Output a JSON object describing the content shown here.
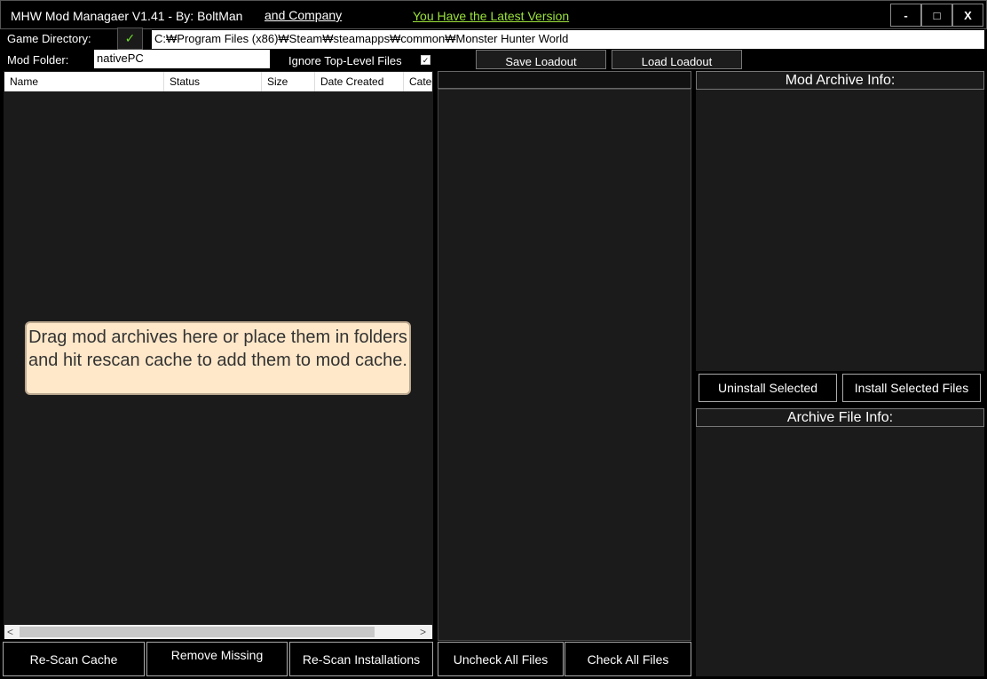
{
  "window": {
    "title": "MHW Mod Managaer V1.41 - By: BoltMan",
    "company_link": "and Company",
    "version_status": "You Have the Latest Version",
    "version_color": "#9be23a",
    "minimize": "-",
    "maximize": "□",
    "close": "X"
  },
  "settings": {
    "game_directory_label": "Game Directory:",
    "game_directory_ok": "✓",
    "game_directory_path": "C:₩Program Files (x86)₩Steam₩steamapps₩common₩Monster Hunter World",
    "mod_folder_label": "Mod Folder:",
    "mod_folder_value": "nativePC",
    "ignore_top_level_label": "Ignore Top-Level Files",
    "ignore_top_level_checked": "✓",
    "save_loadout": "Save Loadout",
    "load_loadout": "Load Loadout"
  },
  "mod_list": {
    "columns": [
      "Name",
      "Status",
      "Size",
      "Date Created",
      "Category"
    ],
    "empty_hint": "Drag mod archives here or place them in folders and hit rescan cache to add them to mod cache.",
    "scroll_left": "<",
    "scroll_right": ">"
  },
  "bottom_buttons": {
    "rescan_cache": "Re-Scan Cache",
    "remove_missing": "Remove Missing",
    "rescan_installations": "Re-Scan Installations",
    "uncheck_all": "Uncheck All Files",
    "check_all": "Check All Files"
  },
  "right_panel": {
    "archive_info_title": "Mod Archive Info:",
    "uninstall_selected": "Uninstall Selected",
    "install_selected": "Install Selected Files",
    "file_info_title": "Archive File Info:"
  }
}
